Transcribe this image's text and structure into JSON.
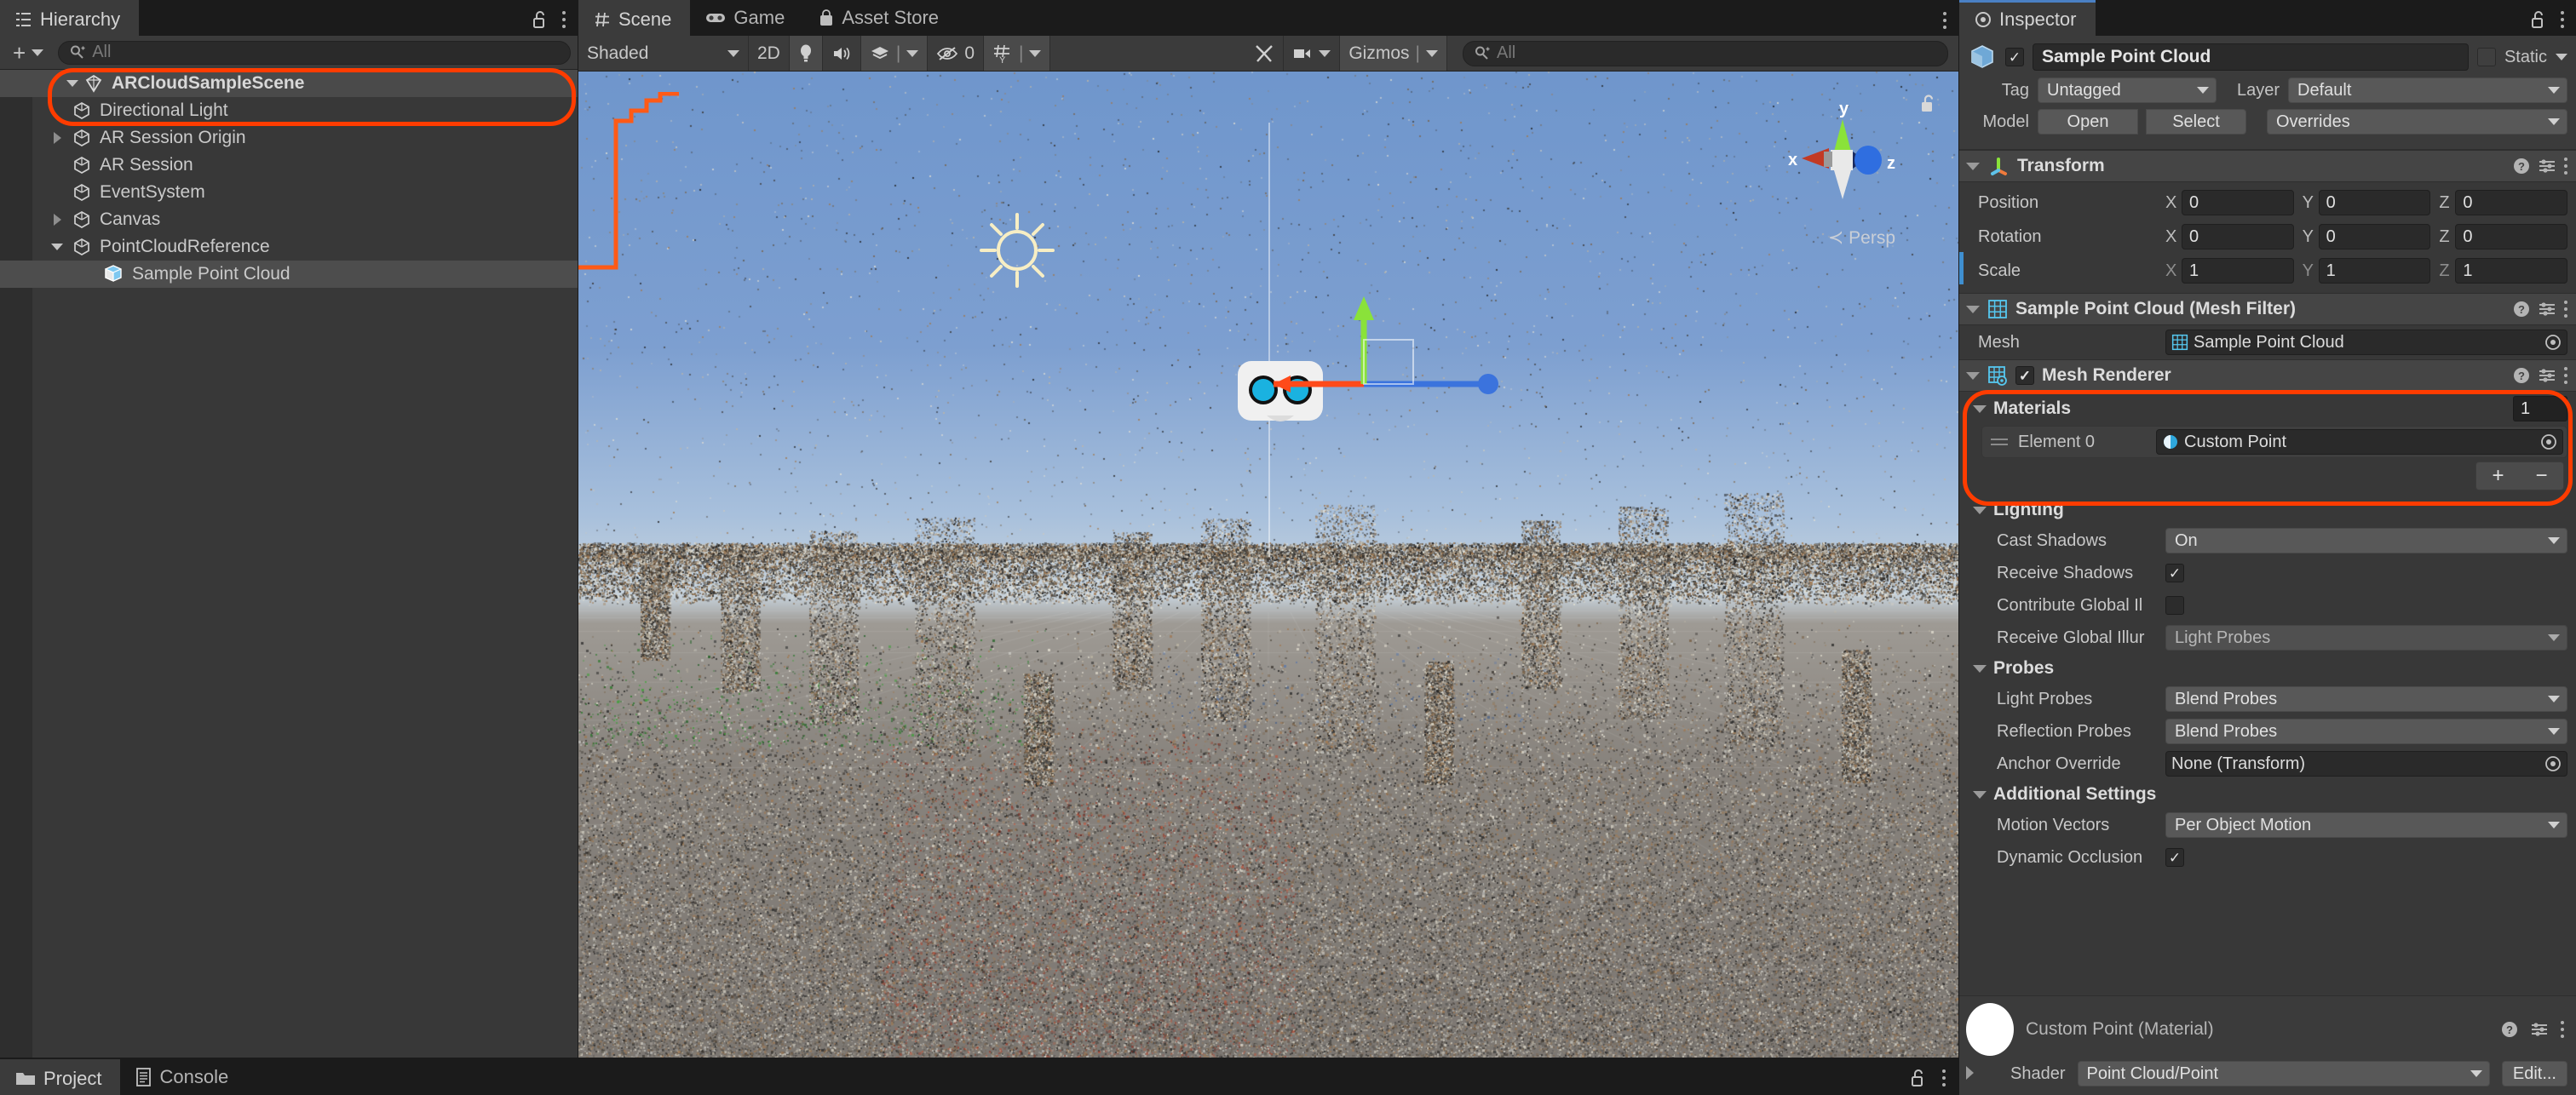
{
  "hierarchy": {
    "tab_label": "Hierarchy",
    "tab_icon": "hierarchy-icon",
    "search_placeholder": "All",
    "add_label": "+",
    "items": [
      {
        "label": "ARCloudSampleScene",
        "icon": "unity-scene-icon",
        "depth": 0,
        "twisty": "down",
        "kind": "scene",
        "selected": false
      },
      {
        "label": "Directional Light",
        "icon": "gameobject-cube-icon",
        "depth": 1,
        "twisty": "none",
        "kind": "object",
        "selected": false
      },
      {
        "label": "AR Session Origin",
        "icon": "gameobject-cube-icon",
        "depth": 1,
        "twisty": "right",
        "kind": "object",
        "selected": false
      },
      {
        "label": "AR Session",
        "icon": "gameobject-cube-icon",
        "depth": 1,
        "twisty": "none",
        "kind": "object",
        "selected": false
      },
      {
        "label": "EventSystem",
        "icon": "gameobject-cube-icon",
        "depth": 1,
        "twisty": "none",
        "kind": "object",
        "selected": false
      },
      {
        "label": "Canvas",
        "icon": "gameobject-cube-icon",
        "depth": 1,
        "twisty": "right",
        "kind": "object",
        "selected": false
      },
      {
        "label": "PointCloudReference",
        "icon": "gameobject-cube-icon",
        "depth": 1,
        "twisty": "down",
        "kind": "object",
        "selected": false
      },
      {
        "label": "Sample Point Cloud",
        "icon": "prefab-mesh-icon",
        "depth": 2,
        "twisty": "none",
        "kind": "mesh",
        "selected": true
      }
    ]
  },
  "scene_panel": {
    "tabs": [
      {
        "label": "Scene",
        "icon": "scene-grid-icon",
        "active": true
      },
      {
        "label": "Game",
        "icon": "gamepad-icon",
        "active": false
      },
      {
        "label": "Asset Store",
        "icon": "asset-store-icon",
        "active": false
      }
    ],
    "toolbar": {
      "draw_mode": "Shaded",
      "two_d_label": "2D",
      "lighting_icon": "lightbulb-icon",
      "audio_icon": "speaker-icon",
      "fx_icon": "fx-layers-icon",
      "hidden_objects_icon": "eye-off-icon",
      "hidden_objects_count": "0",
      "grid_icon": "grid-y-icon",
      "tools_icon": "tools-icon",
      "camera_icon": "camera-icon",
      "gizmos_label": "Gizmos",
      "search_placeholder": "All"
    },
    "overlay": {
      "persp_label": "Persp",
      "axis_x": "x",
      "axis_y": "y",
      "axis_z": "z",
      "lock_icon": "unlock-icon",
      "sun_gizmo_icon": "directional-light-gizmo",
      "headset_gizmo_icon": "ar-headset-gizmo"
    }
  },
  "inspector": {
    "tab_label": "Inspector",
    "tab_icon": "inspector-icon",
    "lock_icon": "unlock-icon",
    "menu_icon": "kebab-menu-icon",
    "object_header": {
      "enabled": true,
      "name": "Sample Point Cloud",
      "static_label": "Static",
      "static_checked": false,
      "tag_label": "Tag",
      "tag_value": "Untagged",
      "layer_label": "Layer",
      "layer_value": "Default",
      "model_label": "Model",
      "open_label": "Open",
      "select_label": "Select",
      "overrides_label": "Overrides"
    },
    "transform": {
      "title": "Transform",
      "icon": "transform-axis-icon",
      "rows": [
        {
          "label": "Position",
          "x": "0",
          "y": "0",
          "z": "0",
          "dim": false
        },
        {
          "label": "Rotation",
          "x": "0",
          "y": "0",
          "z": "0",
          "dim": false
        },
        {
          "label": "Scale",
          "x": "1",
          "y": "1",
          "z": "1",
          "dim": true
        }
      ],
      "axis_x": "X",
      "axis_y": "Y",
      "axis_z": "Z"
    },
    "mesh_filter": {
      "title": "Sample Point Cloud (Mesh Filter)",
      "icon": "mesh-filter-icon",
      "mesh_label": "Mesh",
      "mesh_value": "Sample Point Cloud",
      "mesh_value_icon": "mesh-icon",
      "picker_icon": "object-picker-icon"
    },
    "mesh_renderer": {
      "title": "Mesh Renderer",
      "icon": "mesh-renderer-icon",
      "enabled": true,
      "materials": {
        "title": "Materials",
        "count": "1",
        "element_label": "Element 0",
        "element_value": "Custom Point",
        "element_icon": "material-icon",
        "picker_icon": "object-picker-icon",
        "add_label": "+",
        "remove_label": "−"
      },
      "lighting": {
        "title": "Lighting",
        "cast_shadows_label": "Cast Shadows",
        "cast_shadows_value": "On",
        "receive_shadows_label": "Receive Shadows",
        "receive_shadows_checked": true,
        "contribute_gi_label": "Contribute Global Il",
        "contribute_gi_checked": false,
        "receive_gi_label": "Receive Global Illur",
        "receive_gi_value": "Light Probes"
      },
      "probes": {
        "title": "Probes",
        "light_probes_label": "Light Probes",
        "light_probes_value": "Blend Probes",
        "reflection_probes_label": "Reflection Probes",
        "reflection_probes_value": "Blend Probes",
        "anchor_override_label": "Anchor Override",
        "anchor_override_value": "None (Transform)"
      },
      "additional": {
        "title": "Additional Settings",
        "motion_vectors_label": "Motion Vectors",
        "motion_vectors_value": "Per Object Motion",
        "dynamic_occlusion_label": "Dynamic Occlusion",
        "dynamic_occlusion_checked": true
      }
    },
    "material_preview": {
      "title": "Custom Point (Material)",
      "shader_label": "Shader",
      "shader_value": "Point Cloud/Point",
      "edit_label": "Edit..."
    }
  },
  "bottom_bar": {
    "tabs": [
      {
        "label": "Project",
        "icon": "folder-icon",
        "active": true
      },
      {
        "label": "Console",
        "icon": "console-icon",
        "active": false
      }
    ],
    "lock_icon": "unlock-icon",
    "menu_icon": "kebab-menu-icon"
  },
  "colors": {
    "highlight": "#ff3c00",
    "selection_outline": "#ff5a16",
    "panel_bg": "#383838",
    "toolbar_bg": "#3b3b3b",
    "window_bg": "#1b1b1b",
    "accent_blue": "#4a80c4"
  }
}
